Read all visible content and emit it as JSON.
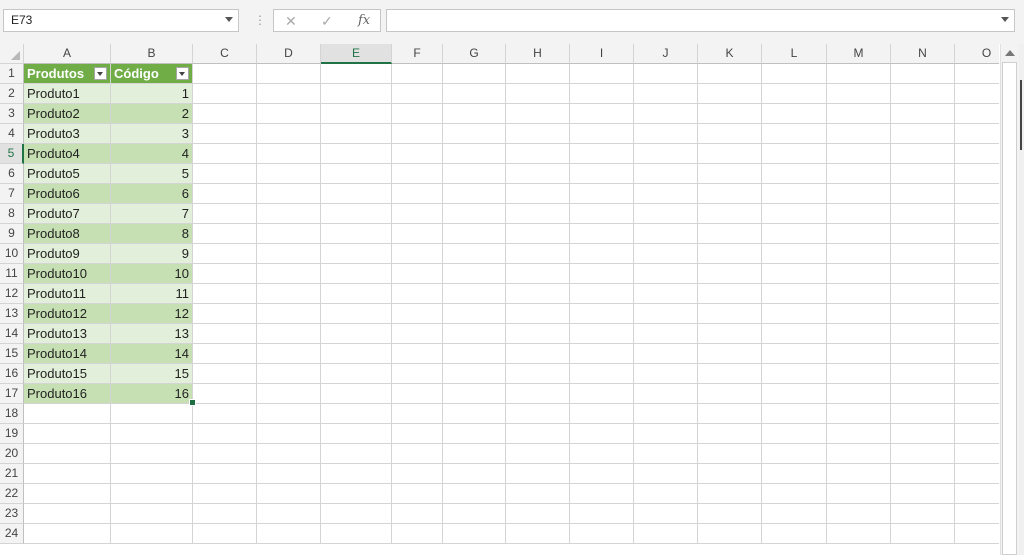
{
  "namebox": {
    "value": "E73"
  },
  "formula_bar": {
    "dots": "⋮",
    "cancel": "✕",
    "enter": "✓",
    "fx": "fx",
    "value": ""
  },
  "columns": [
    "A",
    "B",
    "C",
    "D",
    "E",
    "F",
    "G",
    "H",
    "I",
    "J",
    "K",
    "L",
    "M",
    "N",
    "O"
  ],
  "selected_column": "E",
  "selected_row": 5,
  "row_numbers": [
    1,
    2,
    3,
    4,
    5,
    6,
    7,
    8,
    9,
    10,
    11,
    12,
    13,
    14,
    15,
    16,
    17,
    18,
    19,
    20,
    21,
    22,
    23,
    24
  ],
  "table": {
    "headers": [
      "Produtos",
      "Código"
    ],
    "rows": [
      [
        "Produto1",
        "1"
      ],
      [
        "Produto2",
        "2"
      ],
      [
        "Produto3",
        "3"
      ],
      [
        "Produto4",
        "4"
      ],
      [
        "Produto5",
        "5"
      ],
      [
        "Produto6",
        "6"
      ],
      [
        "Produto7",
        "7"
      ],
      [
        "Produto8",
        "8"
      ],
      [
        "Produto9",
        "9"
      ],
      [
        "Produto10",
        "10"
      ],
      [
        "Produto11",
        "11"
      ],
      [
        "Produto12",
        "12"
      ],
      [
        "Produto13",
        "13"
      ],
      [
        "Produto14",
        "14"
      ],
      [
        "Produto15",
        "15"
      ],
      [
        "Produto16",
        "16"
      ]
    ],
    "header_color": "#70ad47",
    "band_light": "#e2efda",
    "band_dark": "#c6e0b4"
  },
  "accent_color": "#217346"
}
